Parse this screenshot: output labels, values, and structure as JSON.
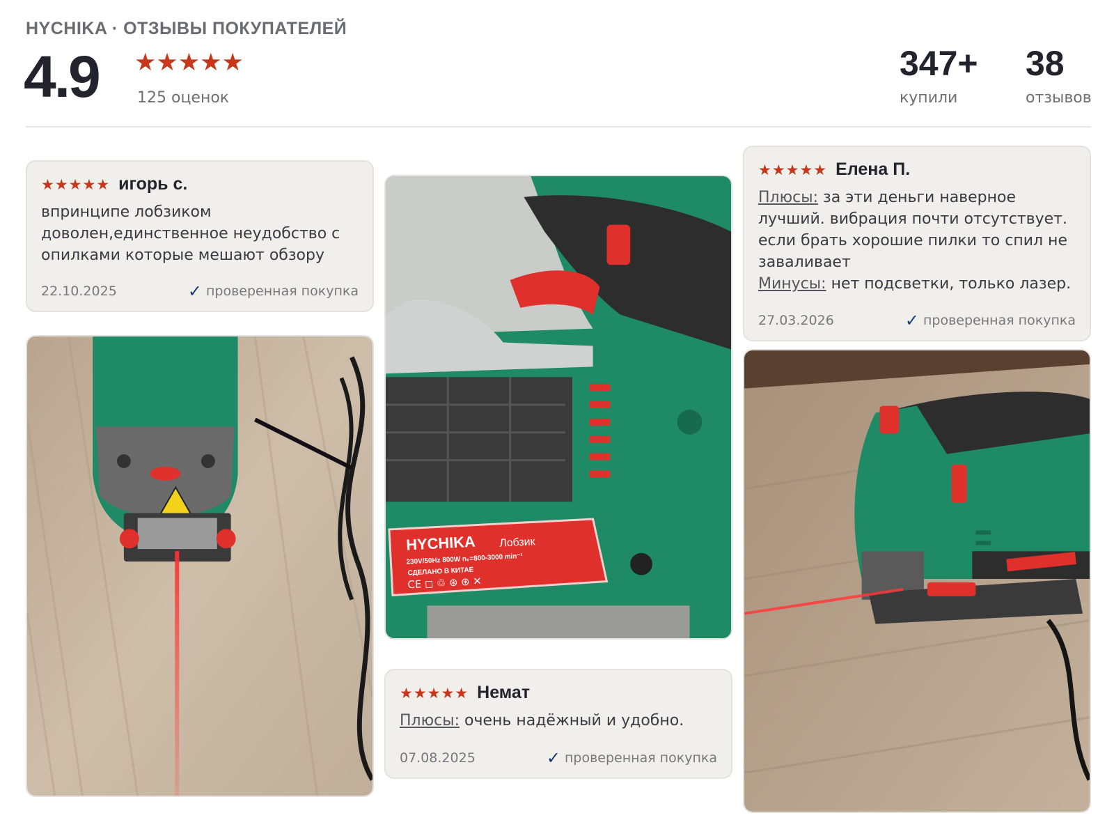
{
  "header": {
    "brand": "HYCHIKA · ОТЗЫВЫ ПОКУПАТЕЛЕЙ",
    "rating": "4.9",
    "stars": "★★★★★",
    "rating_count": "125 оценок",
    "bought_value": "347+",
    "bought_label": "купили",
    "reviews_value": "38",
    "reviews_label": "отзывов"
  },
  "reviews": [
    {
      "stars": "★★★★★",
      "author": "игорь с.",
      "text": "впринципе лобзиком доволен,единственное неудобство с опилками которые мешают обзору",
      "date": "22.10.2025",
      "verified": "проверенная покупка"
    },
    {
      "stars": "★★★★★",
      "author": "Немат",
      "pros_label": "Плюсы:",
      "pros": "очень надёжный и удобно.",
      "date": "07.08.2025",
      "verified": "проверенная покупка"
    },
    {
      "stars": "★★★★★",
      "author": "Елена П.",
      "pros_label": "Плюсы:",
      "pros": "за эти деньги наверное лучший. вибрация почти отсутствует. если брать хорошие пилки то спил не заваливает",
      "cons_label": "Минусы:",
      "cons": "нет подсветки, только лазер.",
      "date": "27.03.2026",
      "verified": "проверенная покупка"
    }
  ],
  "label_plate": {
    "brand": "HYCHIKA",
    "model": "Лобзик",
    "spec": "230V/50Hz 800W n₀=800-3000 min⁻¹",
    "origin": "СДЕЛАНО В КИТАЕ",
    "marks": "CE ◻ ♲ ⊛ ⊛ ✕"
  },
  "colors": {
    "accent_star": "#c9371b",
    "check": "#1c3a74",
    "card_bg": "#f0efec",
    "tool_green": "#1f8a66",
    "tool_red": "#e0302c"
  }
}
